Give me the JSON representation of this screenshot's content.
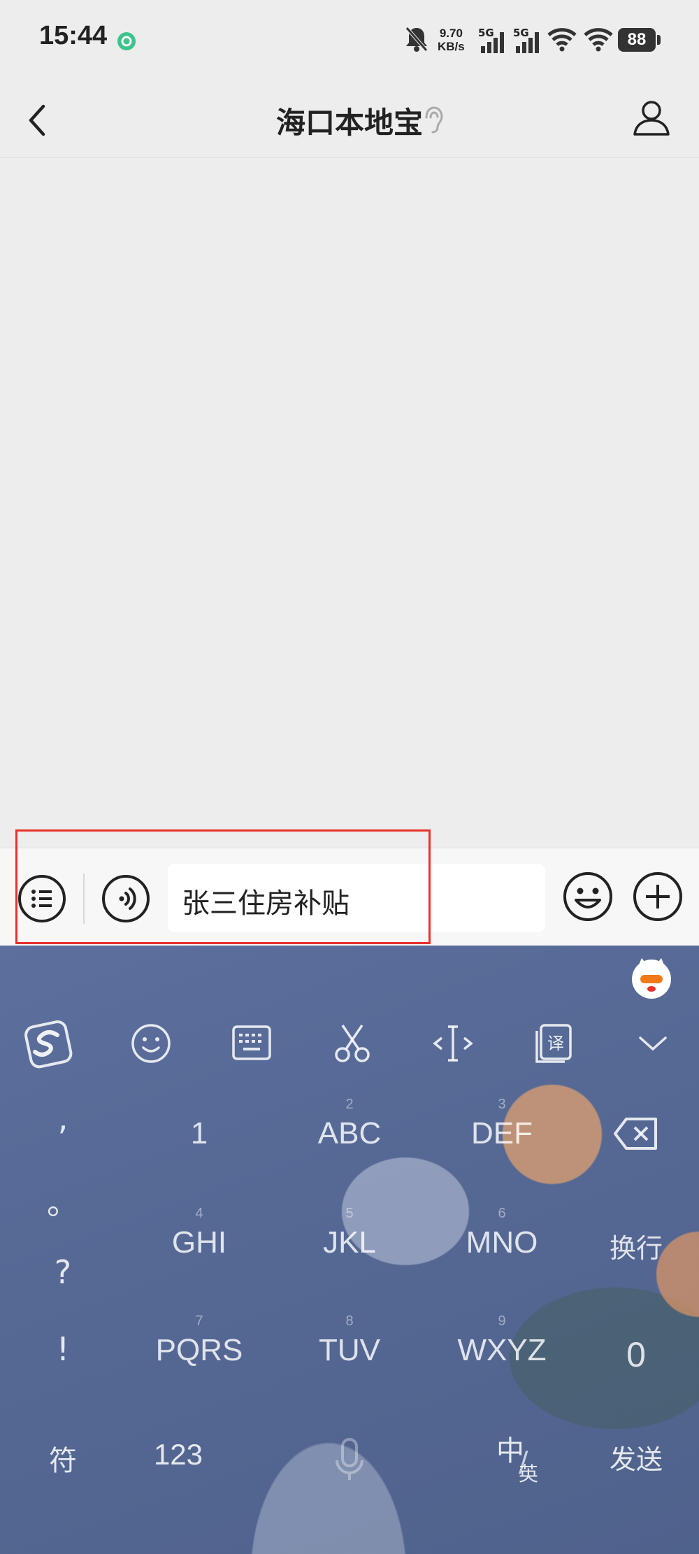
{
  "status": {
    "time": "15:44",
    "net_speed_value": "9.70",
    "net_speed_unit": "KB/s",
    "sim1": "5G",
    "sim2": "5G",
    "battery": "88"
  },
  "nav": {
    "title": "海口本地宝"
  },
  "input": {
    "value": "张三住房补贴"
  },
  "keyboard": {
    "punct": [
      ",",
      "。",
      "?",
      "!"
    ],
    "keys": [
      {
        "main": "1",
        "num": ""
      },
      {
        "main": "ABC",
        "num": "2"
      },
      {
        "main": "DEF",
        "num": "3"
      },
      {
        "main": "GHI",
        "num": "4"
      },
      {
        "main": "JKL",
        "num": "5"
      },
      {
        "main": "MNO",
        "num": "6"
      },
      {
        "main": "PQRS",
        "num": "7"
      },
      {
        "main": "TUV",
        "num": "8"
      },
      {
        "main": "WXYZ",
        "num": "9"
      }
    ],
    "newline": "换行",
    "zero": "0",
    "symbols": "符",
    "numeric": "123",
    "lang_main": "中",
    "lang_sub": "英",
    "send": "发送"
  },
  "colors": {
    "accent": "#e8322a",
    "background": "#ededed",
    "keyboard": "#566995"
  }
}
